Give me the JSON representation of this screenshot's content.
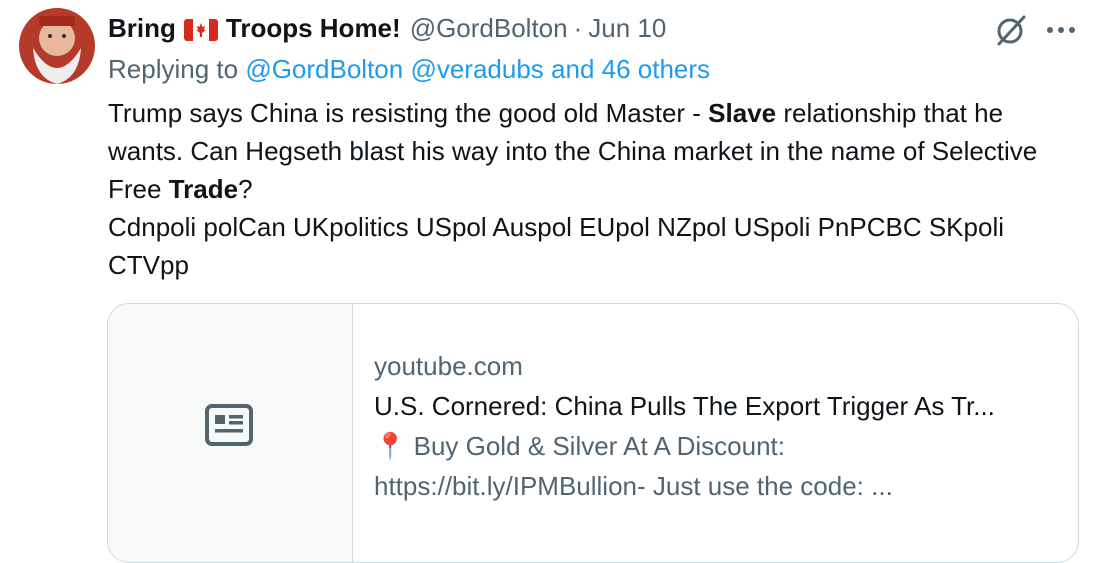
{
  "tweet": {
    "author": {
      "name_part1": "Bring",
      "flag_icon": "canada-flag-icon",
      "name_part2": "Troops Home!",
      "handle": "@GordBolton",
      "separator": "·",
      "date": "Jun 10"
    },
    "reply": {
      "prefix": "Replying to",
      "handles": "@GordBolton @veradubs and 46 others"
    },
    "body": {
      "line1_a": "Trump says China is resisting the good old Master - ",
      "line1_bold": "Slave",
      "line1_b": " relationship that he wants. Can Hegseth blast his way into the China market in the name of Selective Free ",
      "line1_bold2": "Trade",
      "line1_c": "?",
      "hashtags": "Cdnpoli polCan UKpolitics USpol Auspol EUpol NZpol USpoli PnPCBC SKpoli CTVpp"
    },
    "card": {
      "domain": "youtube.com",
      "title": "U.S. Cornered: China Pulls The Export Trigger As Tr...",
      "desc_line1": "📍 Buy Gold & Silver At A Discount:",
      "desc_line2": "https://bit.ly/IPMBullion- Just use the code: ..."
    }
  },
  "icons": {
    "grok": "grok-icon",
    "more": "more-icon",
    "card_placeholder": "article-icon"
  },
  "colors": {
    "text": "#0f1419",
    "secondary": "#536471",
    "link": "#1d9bf0",
    "border": "#cfd9de",
    "flag_red": "#d52b1e"
  }
}
